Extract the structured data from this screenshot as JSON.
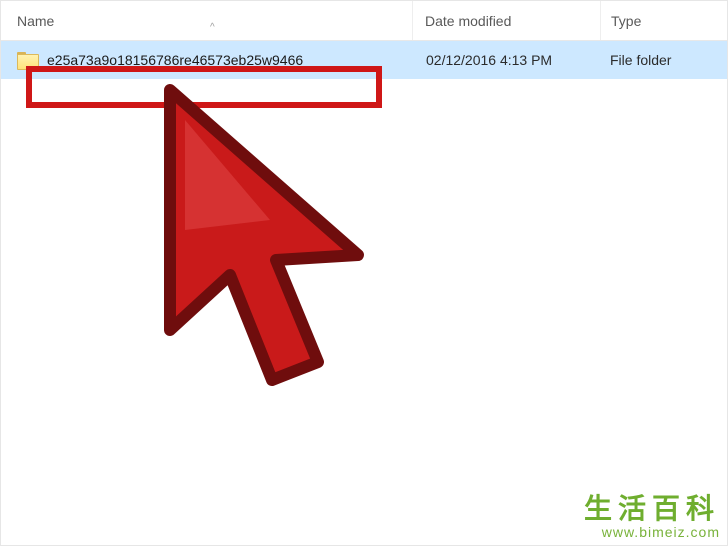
{
  "columns": {
    "name": "Name",
    "modified": "Date modified",
    "type": "Type"
  },
  "item": {
    "name": "e25a73a9o18156786re46573eb25w9466",
    "modified": "02/12/2016 4:13 PM",
    "type": "File folder"
  },
  "sort_caret": "^",
  "watermark": {
    "line1": "生活百科",
    "line2": "www.bimeiz.com"
  }
}
